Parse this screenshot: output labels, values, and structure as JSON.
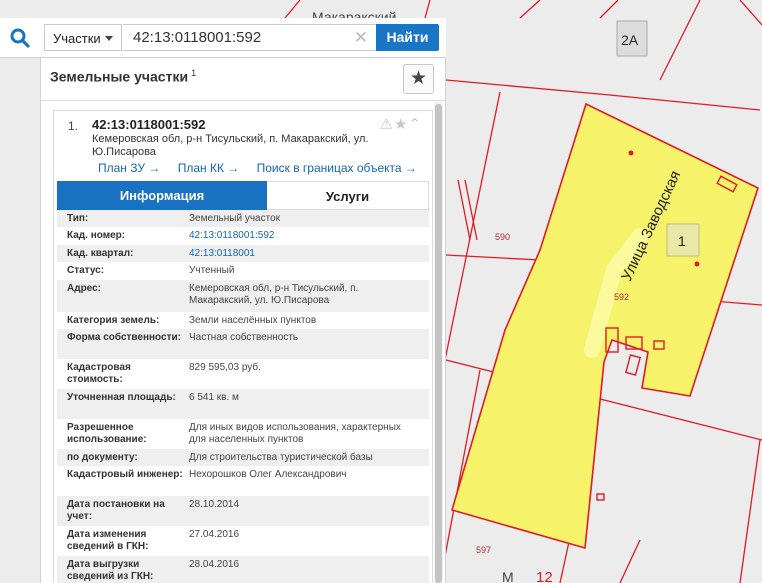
{
  "map": {
    "top_street": "Макаракский",
    "street_label": "Улица Заводская",
    "parcel_label": "592",
    "parcel_590": "590",
    "parcel_597": "597",
    "building_1": "1",
    "building_2a": "2А",
    "bottom_label": "М",
    "bottom_num": "12",
    "colors": {
      "parcel_fill": "#f6f36b",
      "boundary": "#e11b25",
      "background": "#ececec"
    }
  },
  "search": {
    "dropdown_value": "Участки",
    "query": "42:13:0118001:592",
    "clear_glyph": "✕",
    "submit_label": "Найти",
    "icon": "search-icon"
  },
  "panel": {
    "title": "Земельные участки",
    "title_sup": "1",
    "favorite_icon": "star-icon",
    "favorite_glyph": "★"
  },
  "result": {
    "number": "1.",
    "cad_number": "42:13:0118001:592",
    "address": "Кемеровская обл, р-н Тисульский, п. Макаракский, ул. Ю.Писарова",
    "tools_glyph": "⚠★⌃",
    "links": [
      {
        "label": "План ЗУ →"
      },
      {
        "label": "План КК →"
      },
      {
        "label": "Поиск в границах объекта →"
      }
    ],
    "tabs": {
      "info": "Информация",
      "services": "Услуги"
    }
  },
  "info_rows": [
    {
      "key": "Тип:",
      "value": "Земельный участок"
    },
    {
      "key": "Кад. номер:",
      "value": "42:13:0118001:592"
    },
    {
      "key": "Кад. квартал:",
      "value": "42:13:0118001"
    },
    {
      "key": "Статус:",
      "value": "Учтенный"
    },
    {
      "key": "Адрес:",
      "value": "Кемеровская обл, р-н Тисульский, п. Макаракский, ул. Ю.Писарова"
    },
    {
      "key": "Категория земель:",
      "value": "Земли населённых пунктов"
    },
    {
      "key": "Форма собственности:",
      "value": "Частная собственность"
    },
    {
      "key": "Кадастровая стоимость:",
      "value": "829 595,03 руб."
    },
    {
      "key": "Уточненная площадь:",
      "value": "6 541 кв. м"
    },
    {
      "key": "Разрешенное использование:",
      "value": "Для иных видов использования, характерных для населенных пунктов"
    },
    {
      "key": "по документу:",
      "value": "Для строительства туристической базы"
    },
    {
      "key": "Кадастровый инженер:",
      "value": "Нехорошков Олег Александрович"
    },
    {
      "key": "Дата постановки на учет:",
      "value": "28.10.2014"
    },
    {
      "key": "Дата изменения сведений в ГКН:",
      "value": "27.04.2016"
    },
    {
      "key": "Дата выгрузки сведений из ГКН:",
      "value": "28.04.2016"
    }
  ]
}
